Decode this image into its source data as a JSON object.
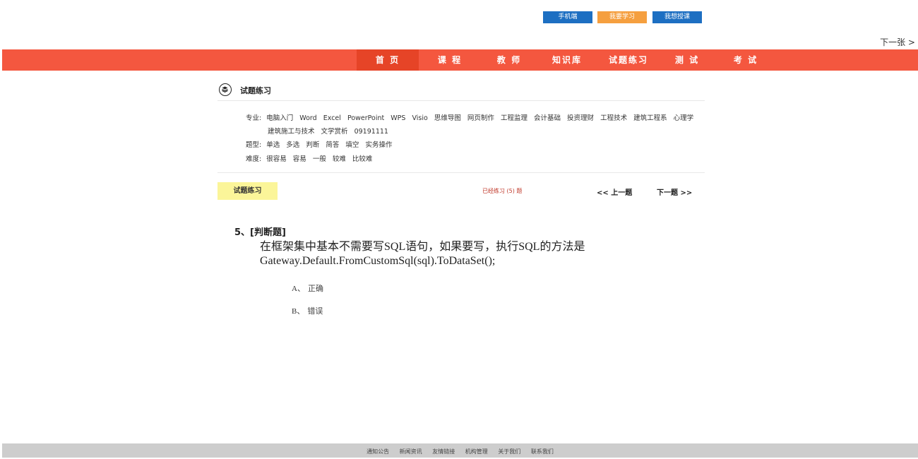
{
  "top_buttons": {
    "mobile": "手机端",
    "learn": "我要学习",
    "teach": "我想授课"
  },
  "next_picture": "下一张 >",
  "nav": {
    "items": [
      "首 页",
      "课 程",
      "教 师",
      "知识库",
      "试题练习",
      "测 试",
      "考 试"
    ],
    "active_index": 0
  },
  "section": {
    "title": "试题练习",
    "icon": "layers-icon"
  },
  "filters": {
    "major_label": "专业:",
    "majors_row1": [
      "电脑入门",
      "Word",
      "Excel",
      "PowerPoint",
      "WPS",
      "Visio",
      "思维导图",
      "网页制作",
      "工程监理",
      "会计基础",
      "投资理财",
      "工程技术",
      "建筑工程系",
      "心理学"
    ],
    "majors_row2": [
      "建筑施工与技术",
      "文学赏析",
      "09191111"
    ],
    "type_label": "题型:",
    "types": [
      "单选",
      "多选",
      "判断",
      "简答",
      "填空",
      "实务操作"
    ],
    "difficulty_label": "难度:",
    "difficulties": [
      "很容易",
      "容易",
      "一般",
      "较难",
      "比较难"
    ]
  },
  "practice": {
    "tab_label": "试题练习",
    "practiced_text": "已经练习 (5) 题",
    "prev_label": "<< 上一题",
    "next_label": "下一题 >>"
  },
  "question": {
    "header": "5、[判断题]",
    "text_line1": "在框架集中基本不需要写SQL语句，如果要写，执行SQL的方法是",
    "text_line2": "Gateway.Default.FromCustomSql(sql).ToDataSet();",
    "options": [
      {
        "key": "A、",
        "text": "正确"
      },
      {
        "key": "B、",
        "text": "错误"
      }
    ]
  },
  "footer": {
    "links": [
      "通知公告",
      "新闻资讯",
      "友情链接",
      "机构管理",
      "关于我们",
      "联系我们"
    ]
  },
  "colors": {
    "nav_bg": "#f4573f",
    "btn_blue": "#1d6fc2",
    "btn_orange": "#f59f3f",
    "tab_yellow": "#fbf599",
    "footer_bg": "#cdcdcd"
  }
}
